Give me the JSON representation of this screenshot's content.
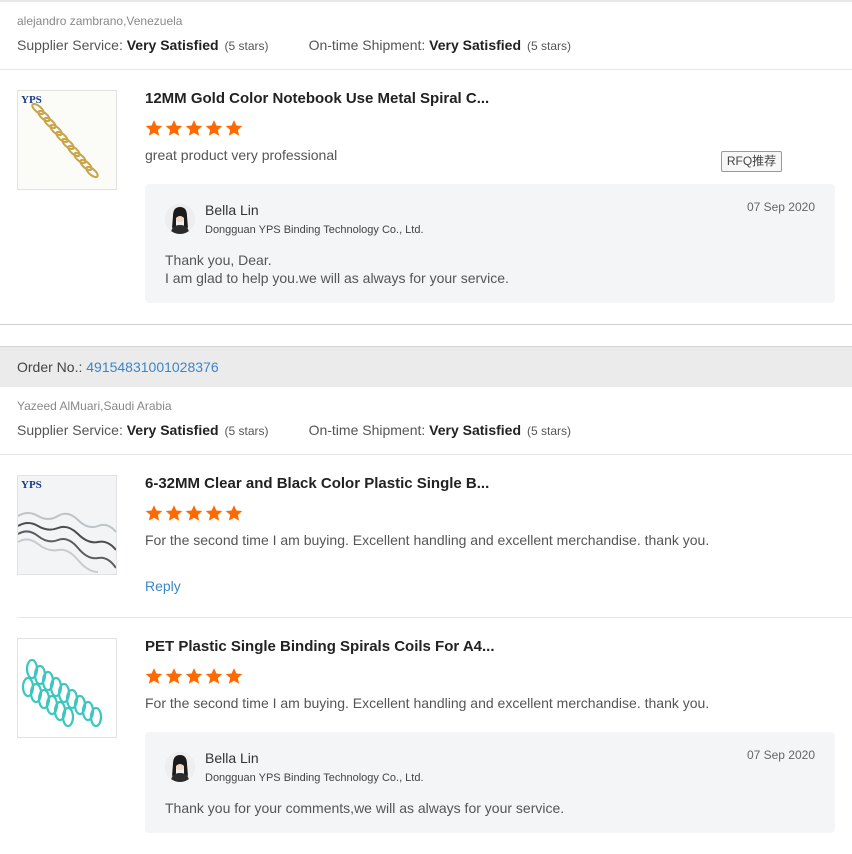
{
  "review1": {
    "buyer": "alejandro zambrano,Venezuela",
    "supplier_service_label": "Supplier Service:",
    "supplier_service_value": "Very Satisfied",
    "supplier_service_stars": "(5 stars)",
    "shipment_label": "On-time Shipment:",
    "shipment_value": "Very Satisfied",
    "shipment_stars": "(5 stars)",
    "product": {
      "title": "12MM Gold Color Notebook Use Metal Spiral C...",
      "rating": 5,
      "comment": "great product very professional",
      "thumb_logo": "YPS"
    },
    "rfq_label": "RFQ推荐",
    "reply": {
      "name": "Bella Lin",
      "company": "Dongguan YPS Binding Technology Co., Ltd.",
      "date": "07 Sep 2020",
      "line1": "Thank you, Dear.",
      "line2": "I am glad to help you.we will as always for your service."
    }
  },
  "order": {
    "label": "Order No.:",
    "number": "49154831001028376"
  },
  "review2": {
    "buyer": "Yazeed AlMuari,Saudi Arabia",
    "supplier_service_label": "Supplier Service:",
    "supplier_service_value": "Very Satisfied",
    "supplier_service_stars": "(5 stars)",
    "shipment_label": "On-time Shipment:",
    "shipment_value": "Very Satisfied",
    "shipment_stars": "(5 stars)",
    "product1": {
      "title": "6-32MM Clear and Black Color Plastic Single B...",
      "rating": 5,
      "comment": "For the second time I am buying.  Excellent handling and excellent merchandise.  thank you.",
      "reply_link": "Reply",
      "thumb_logo": "YPS"
    },
    "product2": {
      "title": "PET Plastic Single Binding Spirals Coils For A4...",
      "rating": 5,
      "comment": "For the second time I am buying.  Excellent handling and excellent merchandise.  thank you.",
      "reply": {
        "name": "Bella Lin",
        "company": "Dongguan YPS Binding Technology Co., Ltd.",
        "date": "07 Sep 2020",
        "line1": "Thank you for your  comments,we will as always for your service."
      }
    }
  },
  "colors": {
    "star": "#ff6a00",
    "link": "#3b86c7",
    "reply_bg": "#f4f5f7",
    "order_bar_bg": "#ebebeb"
  }
}
